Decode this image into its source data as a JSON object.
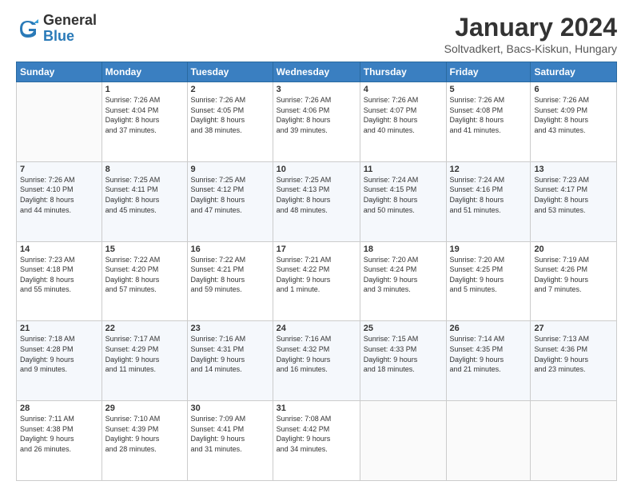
{
  "logo": {
    "general": "General",
    "blue": "Blue"
  },
  "header": {
    "month": "January 2024",
    "location": "Soltvadkert, Bacs-Kiskun, Hungary"
  },
  "weekdays": [
    "Sunday",
    "Monday",
    "Tuesday",
    "Wednesday",
    "Thursday",
    "Friday",
    "Saturday"
  ],
  "weeks": [
    [
      {
        "day": "",
        "info": ""
      },
      {
        "day": "1",
        "info": "Sunrise: 7:26 AM\nSunset: 4:04 PM\nDaylight: 8 hours\nand 37 minutes."
      },
      {
        "day": "2",
        "info": "Sunrise: 7:26 AM\nSunset: 4:05 PM\nDaylight: 8 hours\nand 38 minutes."
      },
      {
        "day": "3",
        "info": "Sunrise: 7:26 AM\nSunset: 4:06 PM\nDaylight: 8 hours\nand 39 minutes."
      },
      {
        "day": "4",
        "info": "Sunrise: 7:26 AM\nSunset: 4:07 PM\nDaylight: 8 hours\nand 40 minutes."
      },
      {
        "day": "5",
        "info": "Sunrise: 7:26 AM\nSunset: 4:08 PM\nDaylight: 8 hours\nand 41 minutes."
      },
      {
        "day": "6",
        "info": "Sunrise: 7:26 AM\nSunset: 4:09 PM\nDaylight: 8 hours\nand 43 minutes."
      }
    ],
    [
      {
        "day": "7",
        "info": "Sunrise: 7:26 AM\nSunset: 4:10 PM\nDaylight: 8 hours\nand 44 minutes."
      },
      {
        "day": "8",
        "info": "Sunrise: 7:25 AM\nSunset: 4:11 PM\nDaylight: 8 hours\nand 45 minutes."
      },
      {
        "day": "9",
        "info": "Sunrise: 7:25 AM\nSunset: 4:12 PM\nDaylight: 8 hours\nand 47 minutes."
      },
      {
        "day": "10",
        "info": "Sunrise: 7:25 AM\nSunset: 4:13 PM\nDaylight: 8 hours\nand 48 minutes."
      },
      {
        "day": "11",
        "info": "Sunrise: 7:24 AM\nSunset: 4:15 PM\nDaylight: 8 hours\nand 50 minutes."
      },
      {
        "day": "12",
        "info": "Sunrise: 7:24 AM\nSunset: 4:16 PM\nDaylight: 8 hours\nand 51 minutes."
      },
      {
        "day": "13",
        "info": "Sunrise: 7:23 AM\nSunset: 4:17 PM\nDaylight: 8 hours\nand 53 minutes."
      }
    ],
    [
      {
        "day": "14",
        "info": "Sunrise: 7:23 AM\nSunset: 4:18 PM\nDaylight: 8 hours\nand 55 minutes."
      },
      {
        "day": "15",
        "info": "Sunrise: 7:22 AM\nSunset: 4:20 PM\nDaylight: 8 hours\nand 57 minutes."
      },
      {
        "day": "16",
        "info": "Sunrise: 7:22 AM\nSunset: 4:21 PM\nDaylight: 8 hours\nand 59 minutes."
      },
      {
        "day": "17",
        "info": "Sunrise: 7:21 AM\nSunset: 4:22 PM\nDaylight: 9 hours\nand 1 minute."
      },
      {
        "day": "18",
        "info": "Sunrise: 7:20 AM\nSunset: 4:24 PM\nDaylight: 9 hours\nand 3 minutes."
      },
      {
        "day": "19",
        "info": "Sunrise: 7:20 AM\nSunset: 4:25 PM\nDaylight: 9 hours\nand 5 minutes."
      },
      {
        "day": "20",
        "info": "Sunrise: 7:19 AM\nSunset: 4:26 PM\nDaylight: 9 hours\nand 7 minutes."
      }
    ],
    [
      {
        "day": "21",
        "info": "Sunrise: 7:18 AM\nSunset: 4:28 PM\nDaylight: 9 hours\nand 9 minutes."
      },
      {
        "day": "22",
        "info": "Sunrise: 7:17 AM\nSunset: 4:29 PM\nDaylight: 9 hours\nand 11 minutes."
      },
      {
        "day": "23",
        "info": "Sunrise: 7:16 AM\nSunset: 4:31 PM\nDaylight: 9 hours\nand 14 minutes."
      },
      {
        "day": "24",
        "info": "Sunrise: 7:16 AM\nSunset: 4:32 PM\nDaylight: 9 hours\nand 16 minutes."
      },
      {
        "day": "25",
        "info": "Sunrise: 7:15 AM\nSunset: 4:33 PM\nDaylight: 9 hours\nand 18 minutes."
      },
      {
        "day": "26",
        "info": "Sunrise: 7:14 AM\nSunset: 4:35 PM\nDaylight: 9 hours\nand 21 minutes."
      },
      {
        "day": "27",
        "info": "Sunrise: 7:13 AM\nSunset: 4:36 PM\nDaylight: 9 hours\nand 23 minutes."
      }
    ],
    [
      {
        "day": "28",
        "info": "Sunrise: 7:11 AM\nSunset: 4:38 PM\nDaylight: 9 hours\nand 26 minutes."
      },
      {
        "day": "29",
        "info": "Sunrise: 7:10 AM\nSunset: 4:39 PM\nDaylight: 9 hours\nand 28 minutes."
      },
      {
        "day": "30",
        "info": "Sunrise: 7:09 AM\nSunset: 4:41 PM\nDaylight: 9 hours\nand 31 minutes."
      },
      {
        "day": "31",
        "info": "Sunrise: 7:08 AM\nSunset: 4:42 PM\nDaylight: 9 hours\nand 34 minutes."
      },
      {
        "day": "",
        "info": ""
      },
      {
        "day": "",
        "info": ""
      },
      {
        "day": "",
        "info": ""
      }
    ]
  ]
}
